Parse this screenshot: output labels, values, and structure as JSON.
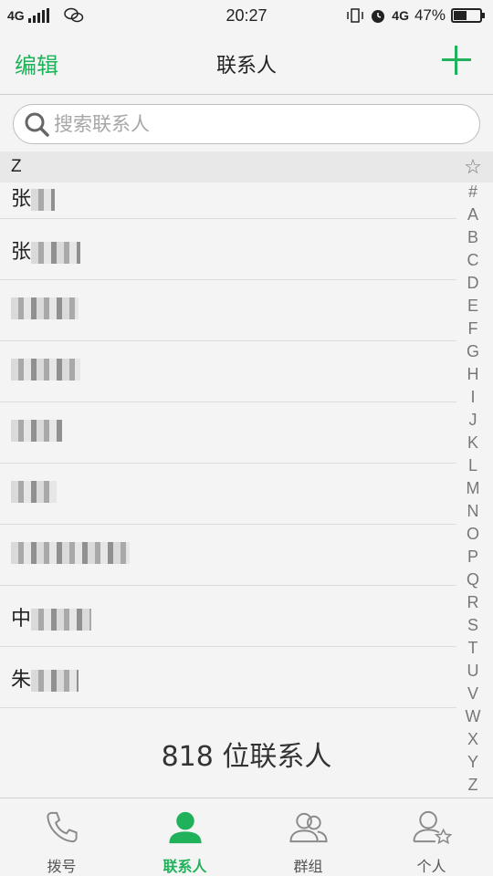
{
  "status_bar": {
    "network": "4G",
    "time": "20:27",
    "network_right": "4G",
    "battery": "47%",
    "battery_level": 0.47
  },
  "header": {
    "edit_label": "编辑",
    "title": "联系人"
  },
  "search": {
    "placeholder": "搜索联系人"
  },
  "section": {
    "letter": "Z"
  },
  "contacts": [
    {
      "visible": "张"
    },
    {
      "visible": "张"
    },
    {
      "visible": ""
    },
    {
      "visible": ""
    },
    {
      "visible": ""
    },
    {
      "visible": ""
    },
    {
      "visible": ""
    },
    {
      "visible": "中"
    },
    {
      "visible": "朱"
    }
  ],
  "contact_count": "818 位联系人",
  "index_bar": {
    "star": "☆",
    "letters": [
      "#",
      "A",
      "B",
      "C",
      "D",
      "E",
      "F",
      "G",
      "H",
      "I",
      "J",
      "K",
      "L",
      "M",
      "N",
      "O",
      "P",
      "Q",
      "R",
      "S",
      "T",
      "U",
      "V",
      "W",
      "X",
      "Y",
      "Z"
    ]
  },
  "tabs": [
    {
      "label": "拨号",
      "icon": "phone-icon"
    },
    {
      "label": "联系人",
      "icon": "person-icon",
      "active": true
    },
    {
      "label": "群组",
      "icon": "group-icon"
    },
    {
      "label": "个人",
      "icon": "person-star-icon"
    }
  ],
  "colors": {
    "accent": "#1fb25a",
    "background": "#f4f4f4"
  }
}
